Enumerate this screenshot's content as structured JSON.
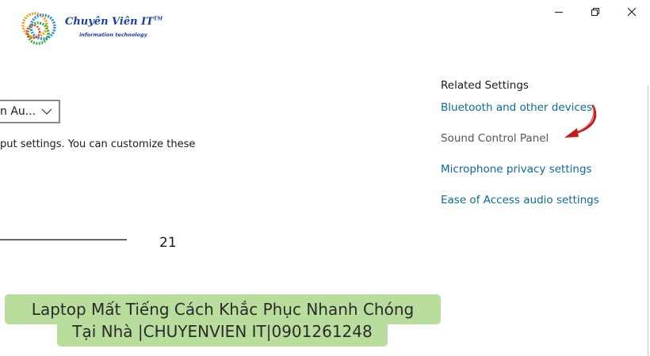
{
  "logo": {
    "title": "Chuyên Viên IT",
    "tm": "TM",
    "subtitle": "information technology"
  },
  "window_controls": {
    "icons": [
      "minimize-icon",
      "restore-icon",
      "close-icon"
    ]
  },
  "main": {
    "dropdown_value": "n Au...",
    "description": "put settings. You can customize these",
    "slider_value": "21"
  },
  "related_settings": {
    "heading": "Related Settings",
    "links": [
      {
        "label": "Bluetooth and other devices",
        "color": "#0a6b9c"
      },
      {
        "label": "Sound Control Panel",
        "color": "#555555"
      },
      {
        "label": "Microphone privacy settings",
        "color": "#0a6b9c"
      },
      {
        "label": "Ease of Access audio settings",
        "color": "#0a6b9c"
      }
    ]
  },
  "annotation": {
    "arrow_color": "#c41a1a"
  },
  "banner": {
    "line1": "Laptop Mất Tiếng Cách Khắc Phục Nhanh Chóng",
    "line2": "Tại Nhà |CHUYENVIEN IT|0901261248",
    "color": "#b8dd9c"
  }
}
